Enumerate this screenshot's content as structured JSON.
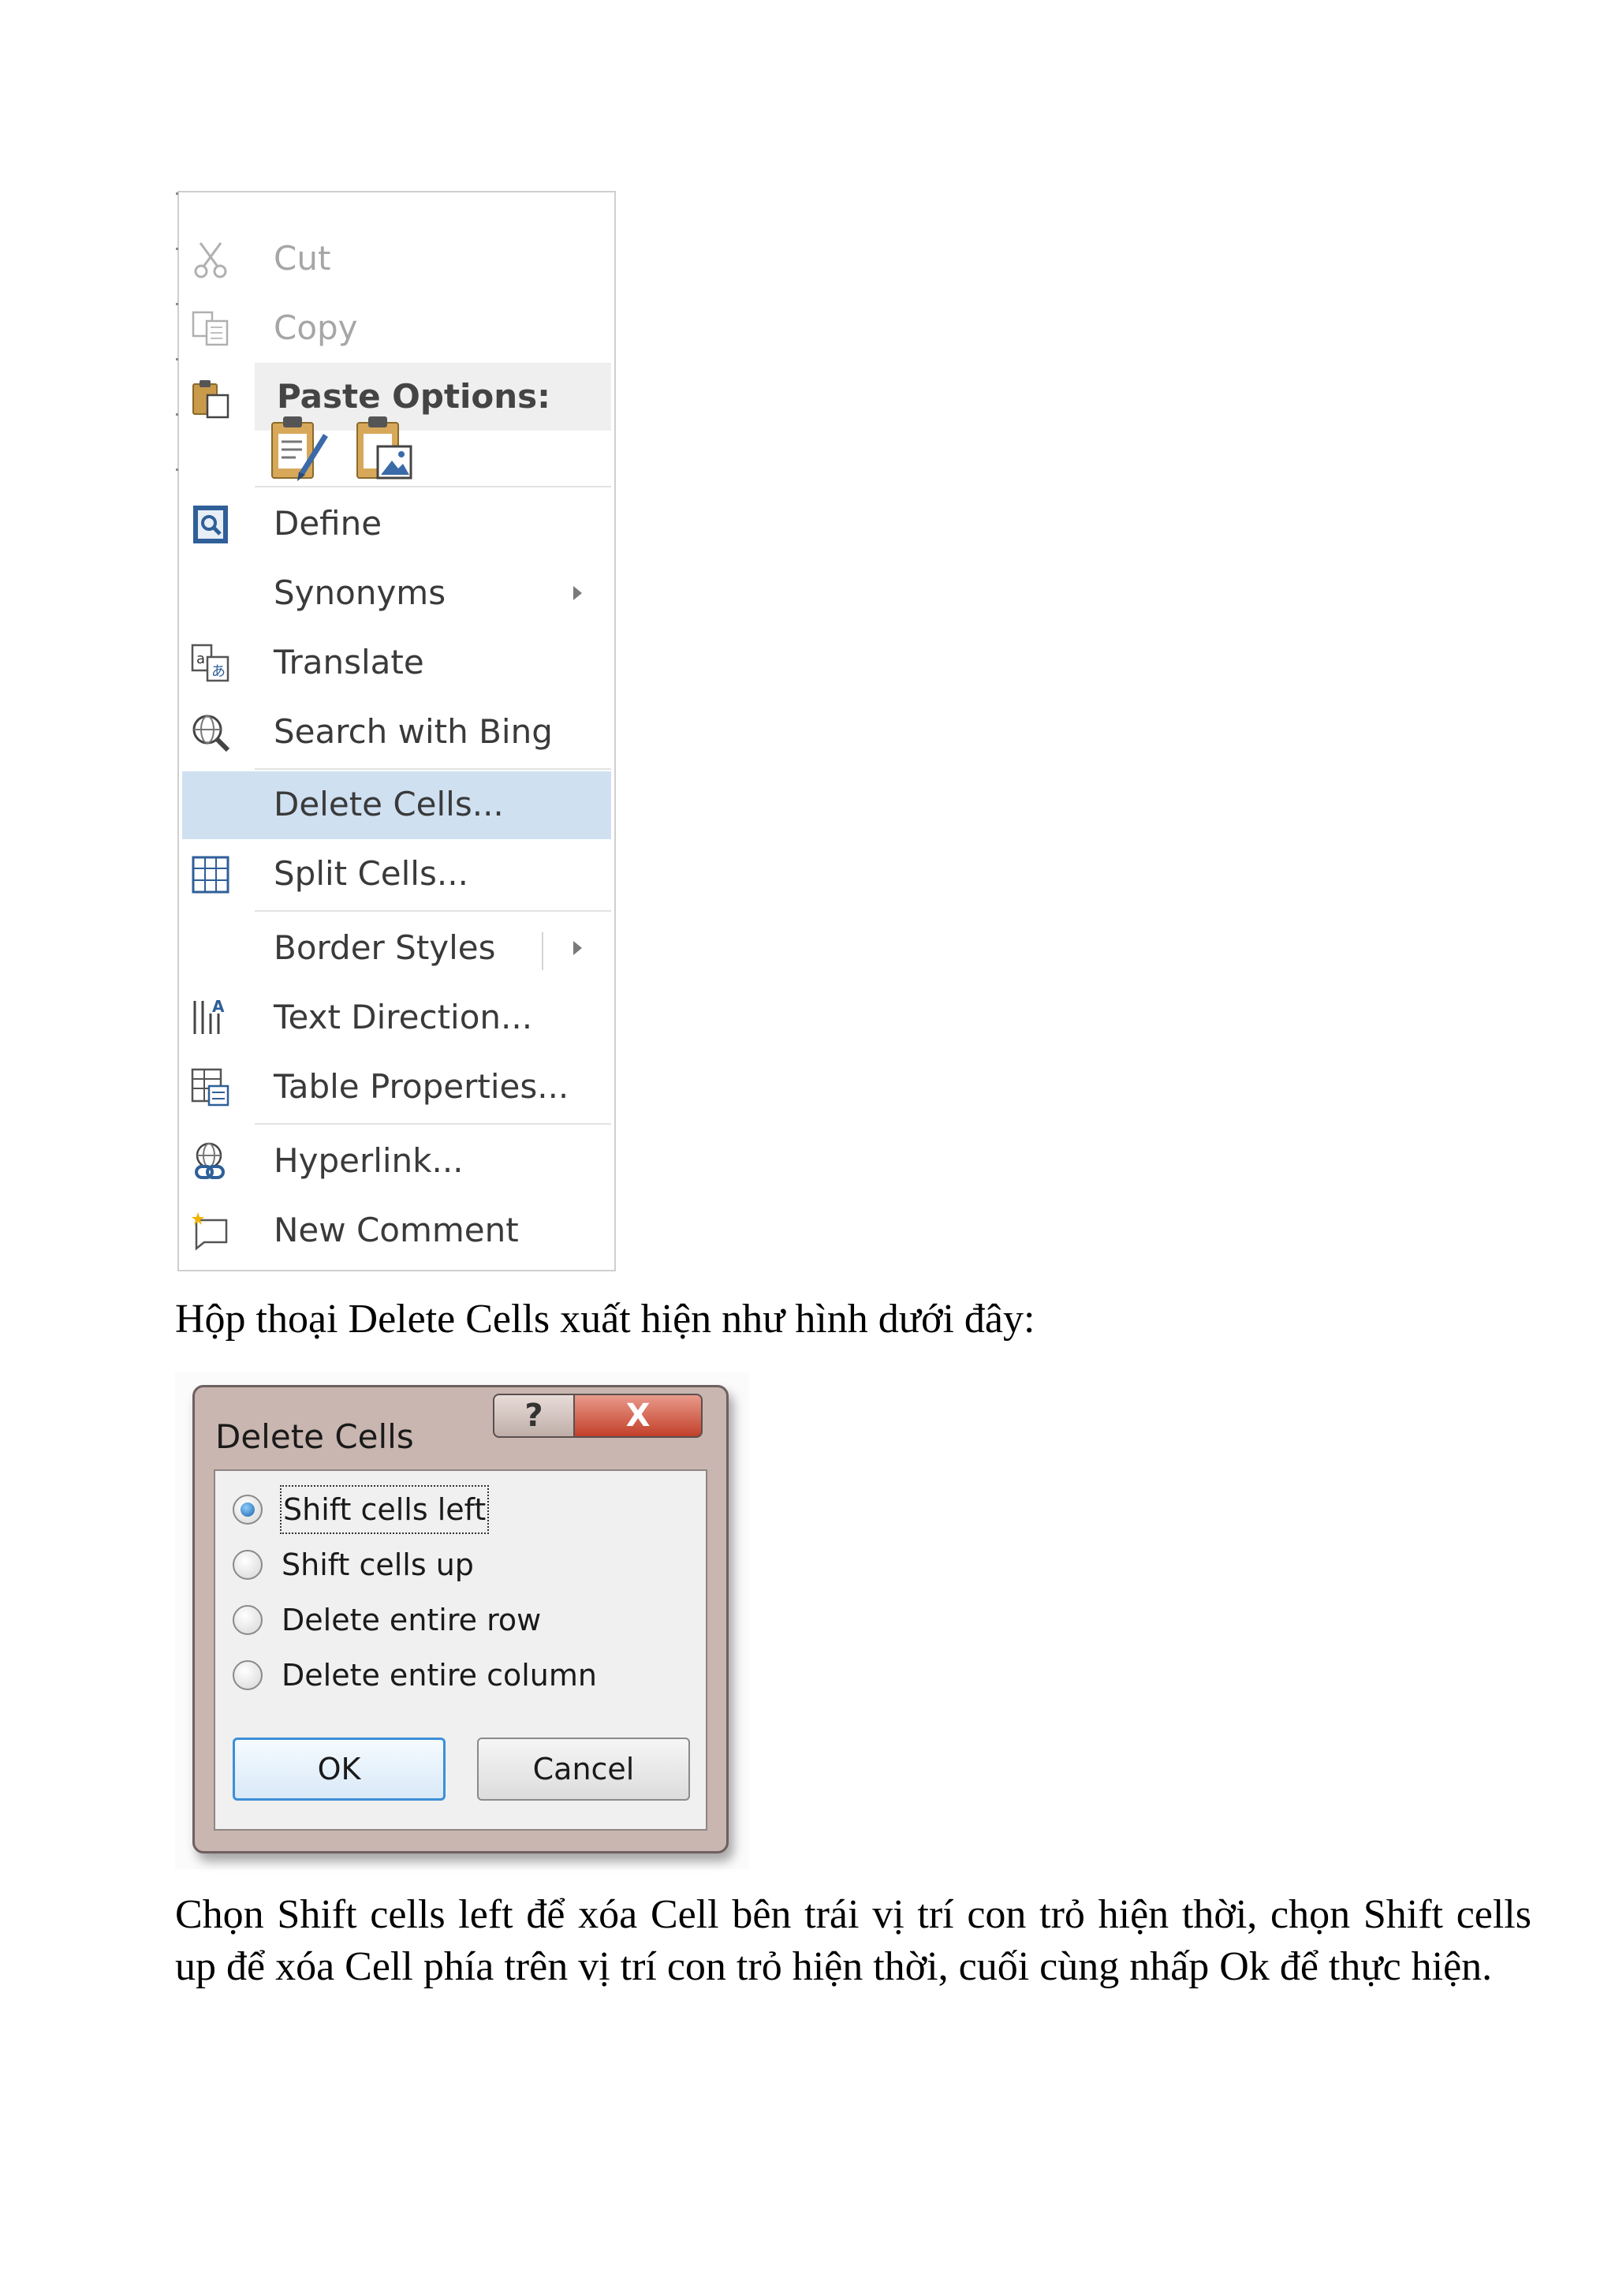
{
  "context_menu": {
    "cut": "Cut",
    "copy": "Copy",
    "paste_options": "Paste Options:",
    "define": "Define",
    "synonyms": "Synonyms",
    "translate": "Translate",
    "search_with_bing": "Search with Bing",
    "delete_cells": "Delete Cells...",
    "split_cells": "Split Cells...",
    "border_styles": "Border Styles",
    "text_direction": "Text Direction...",
    "table_properties": "Table Properties...",
    "hyperlink": "Hyperlink...",
    "new_comment": "New Comment"
  },
  "captions": {
    "first": "Hộp thoại Delete Cells xuất hiện như hình dưới đây:",
    "second": "Chọn Shift cells left để xóa Cell bên trái vị trí con trỏ hiện thời, chọn Shift cells up để xóa Cell phía trên vị trí con trỏ hiện thời, cuối cùng nhấp Ok để thực hiện."
  },
  "dialog": {
    "title": "Delete Cells",
    "help_glyph": "?",
    "close_glyph": "X",
    "options": {
      "shift_left": "Shift cells left",
      "shift_up": "Shift cells up",
      "delete_row": "Delete entire row",
      "delete_column": "Delete entire column"
    },
    "selected_option": "shift_left",
    "ok": "OK",
    "cancel": "Cancel"
  },
  "colors": {
    "menu_highlight": "#cfe0f1",
    "dialog_frame": "#c9b6b0",
    "close_button": "#c2402a",
    "ok_focus_border": "#3c8fd8"
  }
}
